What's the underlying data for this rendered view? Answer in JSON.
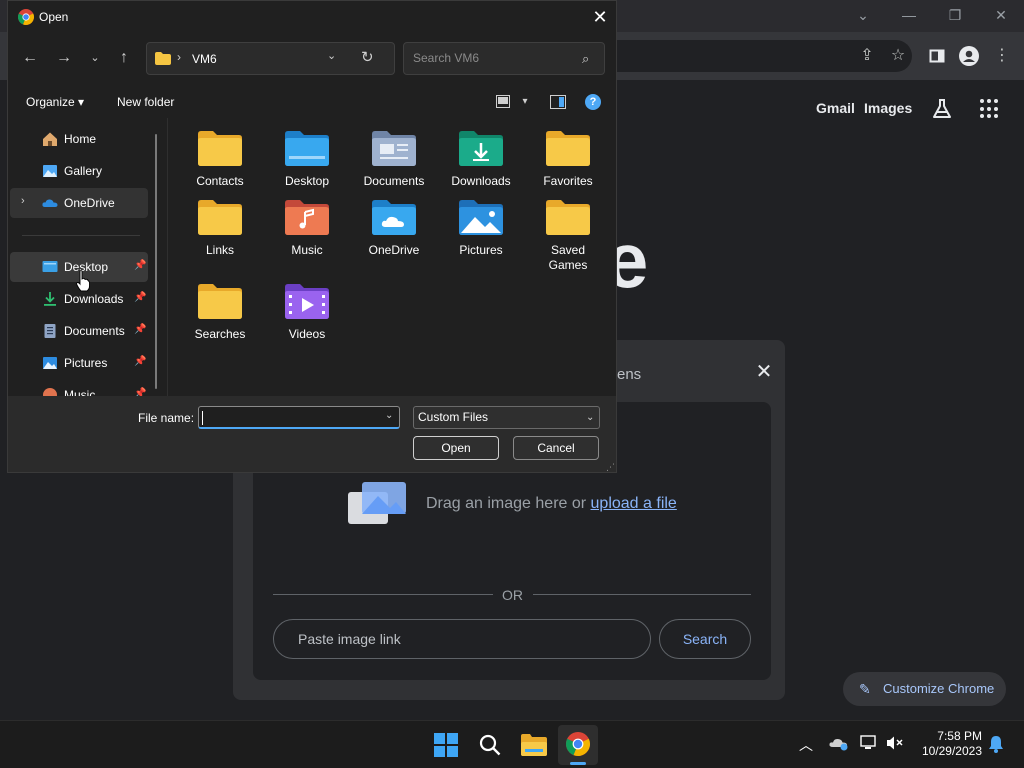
{
  "chrome": {
    "links": {
      "gmail": "Gmail",
      "images": "Images"
    },
    "lens": {
      "title_fragment": "ens",
      "drop_text": "Drag an image here or ",
      "upload_link": "upload a file",
      "or_text": "OR",
      "paste_placeholder": "Paste image link",
      "search_button": "Search"
    },
    "customize_label": "Customize Chrome",
    "logo_fragment": "e"
  },
  "dialog": {
    "title": "Open",
    "address": {
      "path": "VM6",
      "separator": "›"
    },
    "search_placeholder": "Search VM6",
    "toolbar": {
      "organize": "Organize",
      "new_folder": "New folder"
    },
    "nav_items": [
      {
        "label": "Home",
        "icon": "home-icon"
      },
      {
        "label": "Gallery",
        "icon": "gallery-icon"
      },
      {
        "label": "OneDrive",
        "icon": "onedrive-icon"
      },
      {
        "label": "Desktop",
        "icon": "desktop-icon"
      },
      {
        "label": "Downloads",
        "icon": "downloads-icon"
      },
      {
        "label": "Documents",
        "icon": "documents-icon"
      },
      {
        "label": "Pictures",
        "icon": "pictures-icon"
      },
      {
        "label": "Music",
        "icon": "music-icon"
      }
    ],
    "files": [
      {
        "label": "Contacts",
        "icon": "folder-icon"
      },
      {
        "label": "Desktop",
        "icon": "desktop-folder-icon"
      },
      {
        "label": "Documents",
        "icon": "documents-folder-icon"
      },
      {
        "label": "Downloads",
        "icon": "downloads-folder-icon"
      },
      {
        "label": "Favorites",
        "icon": "folder-icon"
      },
      {
        "label": "Links",
        "icon": "folder-icon"
      },
      {
        "label": "Music",
        "icon": "music-folder-icon"
      },
      {
        "label": "OneDrive",
        "icon": "onedrive-folder-icon"
      },
      {
        "label": "Pictures",
        "icon": "pictures-folder-icon"
      },
      {
        "label": "Saved Games",
        "icon": "folder-icon"
      },
      {
        "label": "Searches",
        "icon": "folder-icon"
      },
      {
        "label": "Videos",
        "icon": "videos-folder-icon"
      }
    ],
    "file_name_label": "File name:",
    "file_name_value": "",
    "file_type": "Custom Files",
    "open_button": "Open",
    "cancel_button": "Cancel"
  },
  "taskbar": {
    "time": "7:58 PM",
    "date": "10/29/2023"
  },
  "colors": {
    "accent": "#4ea8f5",
    "folder_yellow": "#f5c542",
    "chrome_link": "#8ab4f8"
  }
}
